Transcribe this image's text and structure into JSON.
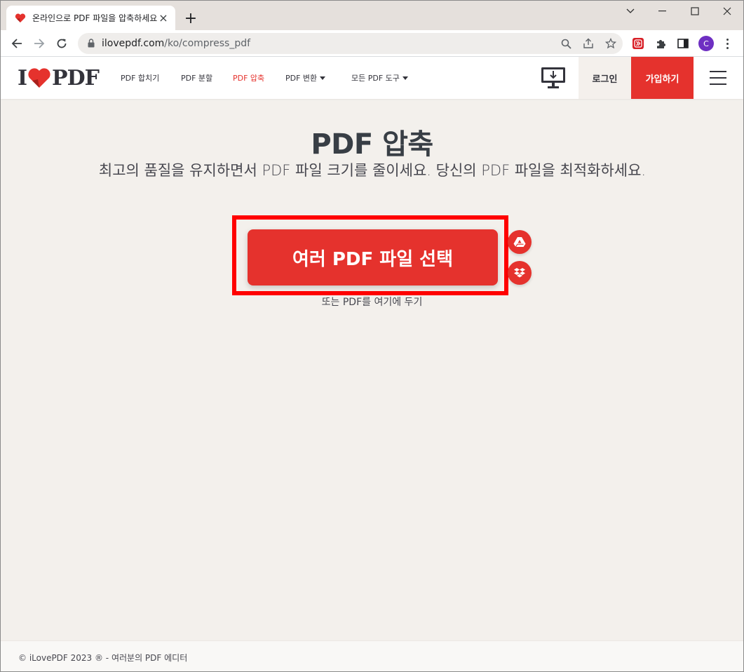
{
  "browser": {
    "tab_title": "온라인으로 PDF 파일을 압축하세요",
    "tab_close": "×",
    "new_tab": "+",
    "url_host": "ilovepdf.com",
    "url_path": "/ko/compress_pdf",
    "profile_initial": "C"
  },
  "header": {
    "logo_left": "I",
    "logo_right": "PDF",
    "nav": [
      {
        "label": "PDF 합치기",
        "active": false
      },
      {
        "label": "PDF 분할",
        "active": false
      },
      {
        "label": "PDF 압축",
        "active": true
      },
      {
        "label": "PDF 변환",
        "active": false
      },
      {
        "label": "모든 PDF 도구",
        "active": false
      }
    ],
    "login": "로그인",
    "signup": "가입하기"
  },
  "main": {
    "title": "PDF 압축",
    "subtitle": "최고의 품질을 유지하면서 PDF 파일 크기를 줄이세요. 당신의 PDF 파일을 최적화하세요.",
    "select_button": "여러 PDF 파일 선택",
    "drop_hint": "또는 PDF를 여기에 두기"
  },
  "footer": {
    "text": "© iLovePDF 2023 ® - 여러분의 PDF 에디터"
  },
  "colors": {
    "brand_red": "#e5322d",
    "highlight": "#ff0000",
    "page_bg": "#f3f0ec"
  }
}
